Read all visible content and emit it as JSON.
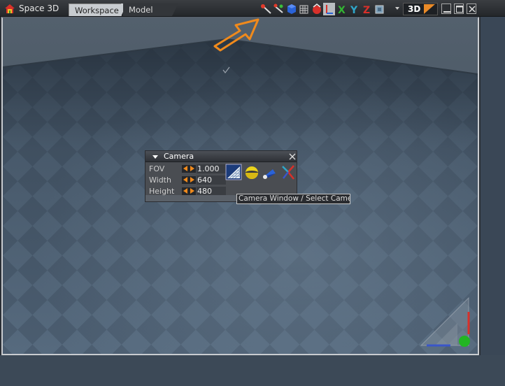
{
  "app": {
    "title": "Space 3D"
  },
  "tabs": [
    {
      "label": "Workspace",
      "active": true
    },
    {
      "label": "Model",
      "active": false
    }
  ],
  "toolbar": {
    "icons": [
      "sphere-wand-icon",
      "multi-wand-icon",
      "blue-cube-icon",
      "grid-cube-icon",
      "red-sphere-icon",
      "axis-pointer-icon",
      "axis-x-icon",
      "axis-y-icon",
      "axis-z-icon",
      "frame-icon"
    ],
    "axis_labels": [
      "X",
      "Y",
      "Z"
    ],
    "view_mode": "3D"
  },
  "camera_panel": {
    "title": "Camera",
    "fields": [
      {
        "label": "FOV",
        "value": "1.000"
      },
      {
        "label": "Width",
        "value": "640"
      },
      {
        "label": "Height",
        "value": "480"
      }
    ]
  },
  "tooltip": {
    "text": "Camera Window / Select Camera"
  },
  "colors": {
    "accent": "#f08a1c",
    "floor_light": "#5a6d80",
    "floor_dark": "#4a5b6c",
    "sky": "#3a4756"
  }
}
